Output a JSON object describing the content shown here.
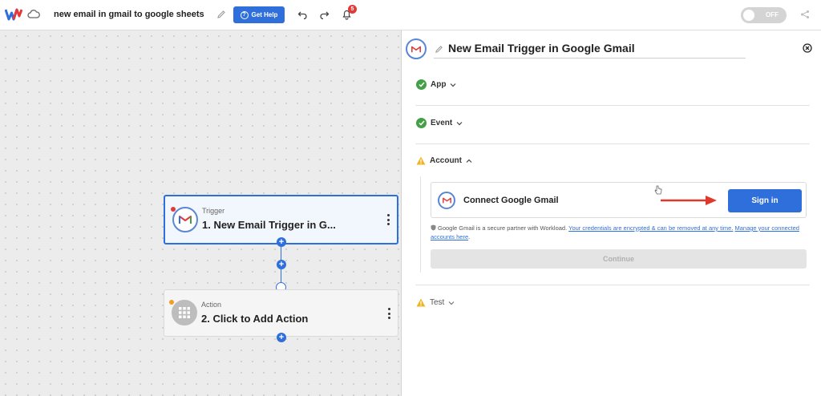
{
  "topbar": {
    "workflow_title": "new email in gmail to google sheets",
    "help_label": "Get Help",
    "notification_count": "5",
    "toggle_label": "OFF"
  },
  "canvas": {
    "trigger": {
      "kind": "Trigger",
      "name": "1. New Email Trigger in G..."
    },
    "action": {
      "kind": "Action",
      "name": "2. Click to Add Action"
    }
  },
  "panel": {
    "title": "New Email Trigger in Google Gmail",
    "sections": {
      "app": "App",
      "event": "Event",
      "account": "Account",
      "test": "Test"
    },
    "account": {
      "connect_label": "Connect Google Gmail",
      "signin_label": "Sign in",
      "note_prefix": "Google Gmail is a secure partner with Workload.",
      "note_link1": "Your credentials are encrypted & can be removed at any time.",
      "note_link2": "Manage your connected accounts here",
      "note_suffix": ".",
      "continue_label": "Continue"
    }
  },
  "colors": {
    "accent": "#2f6fdc",
    "success": "#43a047",
    "warning": "#f0b429",
    "badge": "#e23a3a",
    "arrow": "#e0392b"
  },
  "icons": [
    "workload-logo",
    "cloud-icon",
    "pencil-icon",
    "question-icon",
    "undo-icon",
    "redo-icon",
    "bell-icon",
    "share-icon",
    "gmail-icon",
    "close-icon",
    "check-icon",
    "warning-icon",
    "chevron-icon",
    "grid-icon",
    "shield-icon",
    "arrow-icon",
    "cursor-icon"
  ]
}
